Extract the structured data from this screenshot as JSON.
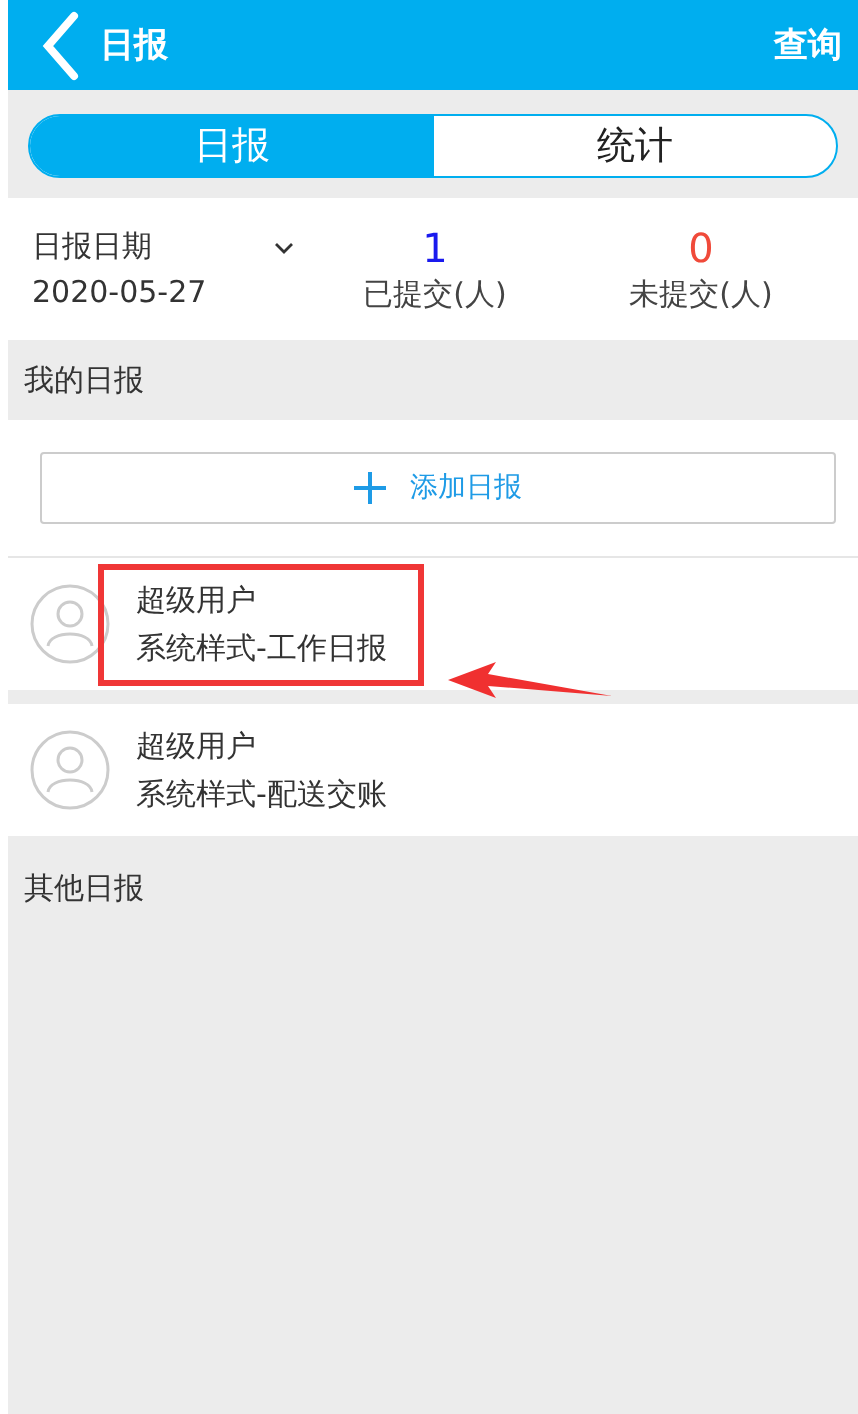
{
  "header": {
    "title": "日报",
    "action": "查询"
  },
  "tabs": [
    {
      "label": "日报",
      "selected": true
    },
    {
      "label": "统计",
      "selected": false
    }
  ],
  "summary": {
    "date_label": "日报日期",
    "date": "2020-05-27",
    "stats": [
      {
        "value": "1",
        "label": "已提交(人)",
        "color": "#1a1aee"
      },
      {
        "value": "0",
        "label": "未提交(人)",
        "color": "#f04a3a"
      }
    ]
  },
  "my_section": {
    "title": "我的日报",
    "add_button": "添加日报",
    "reports": [
      {
        "user": "超级用户",
        "template": "系统样式-工作日报",
        "highlighted": true
      },
      {
        "user": "超级用户",
        "template": "系统样式-配送交账",
        "highlighted": false
      }
    ]
  },
  "other_section": {
    "title": "其他日报"
  }
}
